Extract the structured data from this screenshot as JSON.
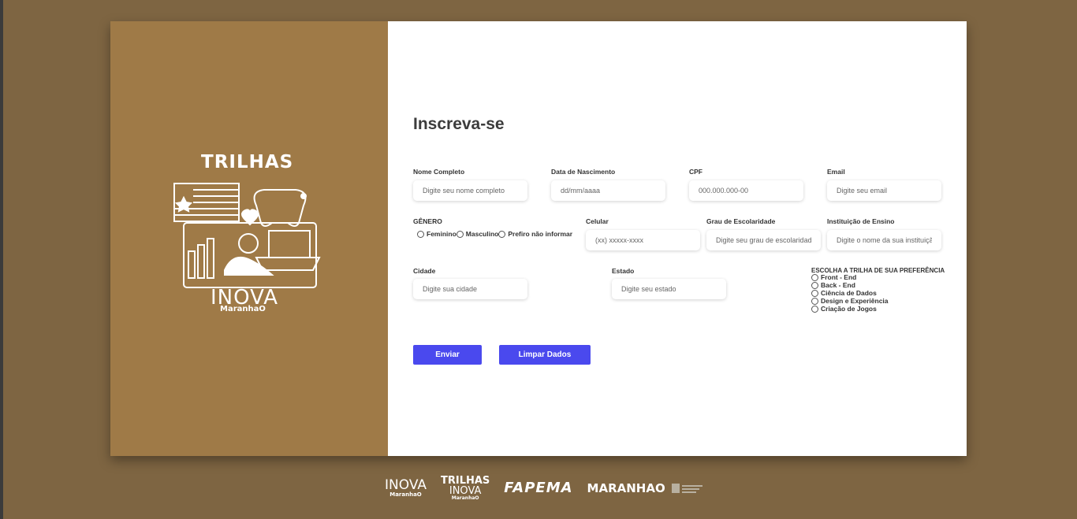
{
  "brand": {
    "logo_top": "TRILHAS",
    "logo_bottom": "INOVA",
    "logo_sub": "MaranhaO"
  },
  "form": {
    "title": "Inscreva-se",
    "nome": {
      "label": "Nome Completo",
      "placeholder": "Digite seu nome completo"
    },
    "nascimento": {
      "label": "Data de Nascimento",
      "placeholder": "dd/mm/aaaa"
    },
    "cpf": {
      "label": "CPF",
      "placeholder": "000.000.000-00"
    },
    "email": {
      "label": "Email",
      "placeholder": "Digite seu email"
    },
    "genero": {
      "label": "GÊNERO",
      "options": [
        "Feminino",
        "Masculino",
        "Prefiro não informar"
      ]
    },
    "celular": {
      "label": "Celular",
      "placeholder": "(xx) xxxxx-xxxx"
    },
    "escolaridade": {
      "label": "Grau de Escolaridade",
      "placeholder": "Digite seu grau de escolaridade"
    },
    "instituicao": {
      "label": "Instituição de Ensino",
      "placeholder": "Digite o nome da sua instituição"
    },
    "cidade": {
      "label": "Cidade",
      "placeholder": "Digite sua cidade"
    },
    "estado": {
      "label": "Estado",
      "placeholder": "Digite seu estado"
    },
    "trilha": {
      "label": "ESCOLHA A TRILHA DE SUA PREFERÊNCIA",
      "options": [
        "Front - End",
        "Back - End",
        "Ciência de Dados",
        "Design e Experiência",
        "Criação de Jogos"
      ]
    },
    "enviar_label": "Enviar",
    "limpar_label": "Limpar Dados"
  },
  "footer": {
    "logo1": "INOVA",
    "logo1_sub": "MaranhaO",
    "logo2_a": "TRILHAS",
    "logo2_b": "INOVA",
    "logo2_sub": "MaranhaO",
    "logo3": "FAPEMA",
    "logo4": "MARANHAO"
  },
  "colors": {
    "background": "#7e6542",
    "panel": "#9f7a47",
    "button": "#4a49ee"
  }
}
